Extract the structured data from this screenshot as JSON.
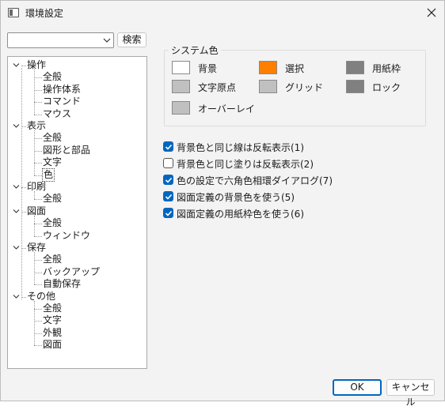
{
  "window": {
    "title": "環境設定"
  },
  "search": {
    "value": "",
    "button_label": "検索"
  },
  "tree": {
    "items": [
      {
        "label": "操作",
        "level": 0,
        "expanded": true
      },
      {
        "label": "全般",
        "level": 1
      },
      {
        "label": "操作体系",
        "level": 1
      },
      {
        "label": "コマンド",
        "level": 1
      },
      {
        "label": "マウス",
        "level": 1
      },
      {
        "label": "表示",
        "level": 0,
        "expanded": true
      },
      {
        "label": "全般",
        "level": 1
      },
      {
        "label": "図形と部品",
        "level": 1
      },
      {
        "label": "文字",
        "level": 1
      },
      {
        "label": "色",
        "level": 1,
        "selected": true
      },
      {
        "label": "印刷",
        "level": 0,
        "expanded": true
      },
      {
        "label": "全般",
        "level": 1
      },
      {
        "label": "図面",
        "level": 0,
        "expanded": true
      },
      {
        "label": "全般",
        "level": 1
      },
      {
        "label": "ウィンドウ",
        "level": 1
      },
      {
        "label": "保存",
        "level": 0,
        "expanded": true
      },
      {
        "label": "全般",
        "level": 1
      },
      {
        "label": "バックアップ",
        "level": 1
      },
      {
        "label": "自動保存",
        "level": 1
      },
      {
        "label": "その他",
        "level": 0,
        "expanded": true
      },
      {
        "label": "全般",
        "level": 1
      },
      {
        "label": "文字",
        "level": 1
      },
      {
        "label": "外観",
        "level": 1
      },
      {
        "label": "図面",
        "level": 1
      }
    ]
  },
  "system_colors": {
    "title": "システム色",
    "items": [
      {
        "label": "背景",
        "color": "#ffffff"
      },
      {
        "label": "選択",
        "color": "#ff8000"
      },
      {
        "label": "用紙枠",
        "color": "#808080"
      },
      {
        "label": "文字原点",
        "color": "#c0c0c0"
      },
      {
        "label": "グリッド",
        "color": "#c0c0c0"
      },
      {
        "label": "ロック",
        "color": "#808080"
      },
      {
        "label": "オーバーレイ",
        "color": "#c0c0c0"
      }
    ]
  },
  "options": [
    {
      "label": "背景色と同じ線は反転表示(1)",
      "checked": true
    },
    {
      "label": "背景色と同じ塗りは反転表示(2)",
      "checked": false
    },
    {
      "label": "色の設定で六角色相環ダイアログ(7)",
      "checked": true
    },
    {
      "label": "図面定義の背景色を使う(5)",
      "checked": true
    },
    {
      "label": "図面定義の用紙枠色を使う(6)",
      "checked": true
    }
  ],
  "buttons": {
    "ok_label": "OK",
    "cancel_label": "キャンセル"
  },
  "accent_color": "#0067c0"
}
